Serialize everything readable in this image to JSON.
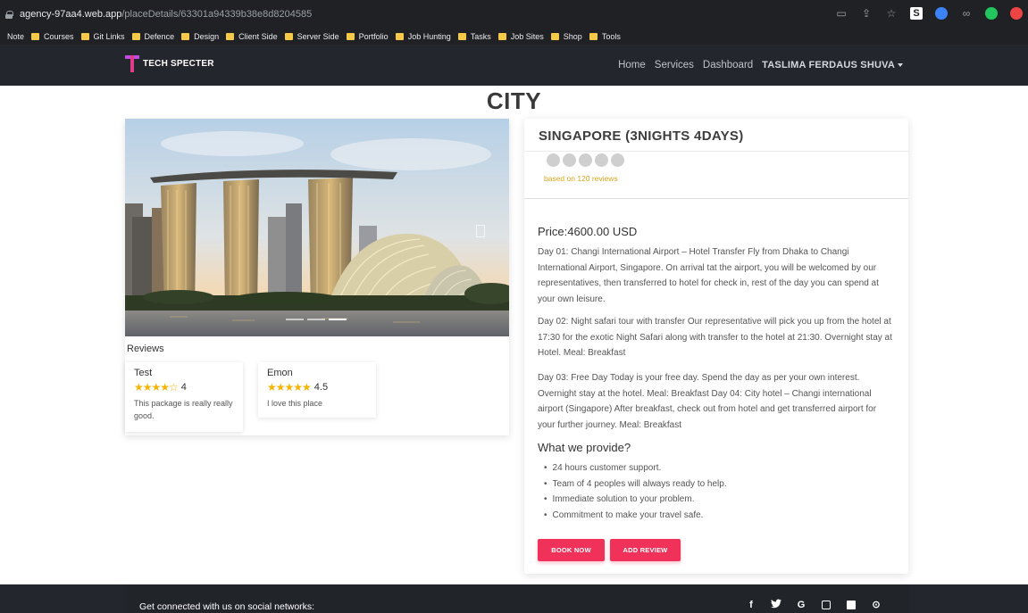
{
  "browser": {
    "url_host": "agency-97aa4.web.app",
    "url_path": "/placeDetails/63301a94339b38e8d8204585",
    "bookmarks": [
      "Note",
      "Courses",
      "Git Links",
      "Defence",
      "Design",
      "Client Side",
      "Server Side",
      "Portfolio",
      "Job Hunting",
      "Tasks",
      "Job Sites",
      "Shop",
      "Tools"
    ],
    "ext_s_label": "S"
  },
  "navbar": {
    "brand": "TECH SPECTER",
    "links": [
      "Home",
      "Services",
      "Dashboard"
    ],
    "user": "TASLIMA FERDAUS SHUVA"
  },
  "page": {
    "title": "CITY"
  },
  "carousel": {
    "slide_count": 3,
    "active_slide": 3
  },
  "reviews": {
    "title": "Reviews",
    "items": [
      {
        "name": "Test",
        "rating": "4",
        "stars": "★★★★☆",
        "text": "This package is really really good."
      },
      {
        "name": "Emon",
        "rating": "4.5",
        "stars": "★★★★★",
        "text": "I love this place"
      }
    ]
  },
  "package": {
    "title": "SINGAPORE (3NIGHTS 4DAYS)",
    "based_on": "based on 120 reviews",
    "price": "Price:4600.00 USD",
    "day1": "Day 01: Changi International Airport – Hotel Transfer Fly from Dhaka to Changi International Airport, Singapore. On arrival tat the airport, you will be welcomed by our representatives, then transferred to hotel for check in, rest of the day you can spend at your own leisure.",
    "day2": "Day 02: Night safari tour with transfer Our representative will pick you up from the hotel at 17:30 for the exotic Night Safari along with transfer to the hotel at 21:30. Overnight stay at Hotel. Meal: Breakfast",
    "day3": "Day 03: Free Day Today is your free day. Spend the day as per your own interest. Overnight stay at the hotel. Meal: Breakfast Day 04: City hotel – Changi international airport (Singapore) After breakfast, check out from hotel and get transferred airport for your further journey. Meal: Breakfast",
    "provide_title": "What we provide?",
    "provide_items": [
      "24 hours customer support.",
      "Team of 4 peoples will always ready to help.",
      "Immediate solution to your problem.",
      "Commitment to make your travel safe."
    ],
    "book_label": "BOOK NOW",
    "review_label": "ADD REVIEW"
  },
  "footer": {
    "text": "Get connected with us on social networks:",
    "icons": [
      "facebook-icon",
      "twitter-icon",
      "google-icon",
      "instagram-icon",
      "linkedin-icon",
      "github-icon"
    ],
    "f_glyph": "f",
    "t_glyph": "🐦",
    "g_glyph": "G",
    "gh_glyph": "⊙"
  }
}
